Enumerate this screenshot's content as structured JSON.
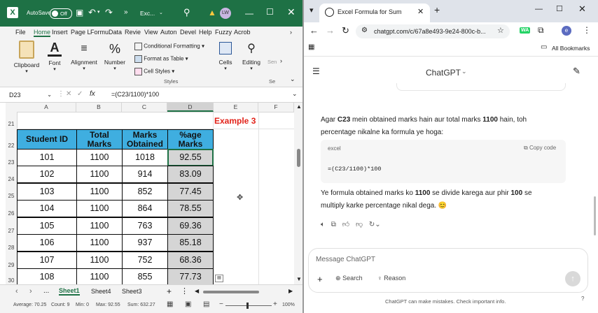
{
  "excel": {
    "autosave_label": "AutoSave",
    "autosave_state": "Off",
    "file_title": "Exc...",
    "user_initials": "LW",
    "ribbon_tabs": [
      "File",
      "Home",
      "Insert",
      "Page L",
      "Formu",
      "Data",
      "Revie",
      "View",
      "Auton",
      "Devel",
      "Help",
      "Fuzzy",
      "Acrob"
    ],
    "ribbon": {
      "clipboard": "Clipboard",
      "font": "Font",
      "alignment": "Alignment",
      "number": "Number",
      "cond_format": "Conditional Formatting",
      "format_table": "Format as Table",
      "cell_styles": "Cell Styles",
      "styles_group": "Styles",
      "cells": "Cells",
      "editing": "Editing",
      "sen": "Sen",
      "se": "Se"
    },
    "name_box": "D23",
    "fx": "fx",
    "formula": "=(C23/1100)*100",
    "columns": [
      "A",
      "B",
      "C",
      "D",
      "E",
      "F"
    ],
    "row_numbers": [
      "21",
      "22",
      "23",
      "24",
      "25",
      "26",
      "27",
      "28",
      "29",
      "30"
    ],
    "example_label": "Example 3",
    "headers": [
      "Student ID",
      "Total Marks",
      "Marks Obtained",
      "%age Marks"
    ],
    "rows": [
      [
        "101",
        "1100",
        "1018",
        "92.55"
      ],
      [
        "102",
        "1100",
        "914",
        "83.09"
      ],
      [
        "103",
        "1100",
        "852",
        "77.45"
      ],
      [
        "104",
        "1100",
        "864",
        "78.55"
      ],
      [
        "105",
        "1100",
        "763",
        "69.36"
      ],
      [
        "106",
        "1100",
        "937",
        "85.18"
      ],
      [
        "107",
        "1100",
        "752",
        "68.36"
      ],
      [
        "108",
        "1100",
        "855",
        "77.73"
      ]
    ],
    "sheets": [
      "Sheet1",
      "Sheet4",
      "Sheet3"
    ],
    "ellipsis": "...",
    "status": {
      "average": "Average: 70.25",
      "count": "Count: 9",
      "min": "Min: 0",
      "max": "Max: 92.55",
      "sum": "Sum: 632.27",
      "zoom": "100%"
    },
    "colors": {
      "title_bar": "#1e7145",
      "header_fill": "#3faee0",
      "grey_fill": "#d5d5d5",
      "example": "#e2231a"
    }
  },
  "chrome": {
    "tab_title": "Excel Formula for Sum",
    "url": "chatgpt.com/c/67a8e493-9e24-800c-b...",
    "all_bookmarks": "All Bookmarks",
    "chatgpt_title": "ChatGPT",
    "profile_initial": "e",
    "wa": "WA",
    "para1_pre": "Agar ",
    "para1_b1": "C23",
    "para1_mid": " mein obtained marks hain aur total marks ",
    "para1_b2": "1100",
    "para1_post": " hain, toh percentage nikalne ka formula ye hoga:",
    "code_lang": "excel",
    "copy_code": "Copy code",
    "code": "=(C23/1100)*100",
    "para2_pre": "Ye formula obtained marks ko ",
    "para2_b1": "1100",
    "para2_mid": " se divide karega aur phir ",
    "para2_b2": "100",
    "para2_post": " se multiply karke percentage nikal dega.",
    "emoji": "😊",
    "message_placeholder": "Message ChatGPT",
    "search": "Search",
    "reason": "Reason",
    "disclaimer": "ChatGPT can make mistakes. Check important info.",
    "help": "?"
  }
}
